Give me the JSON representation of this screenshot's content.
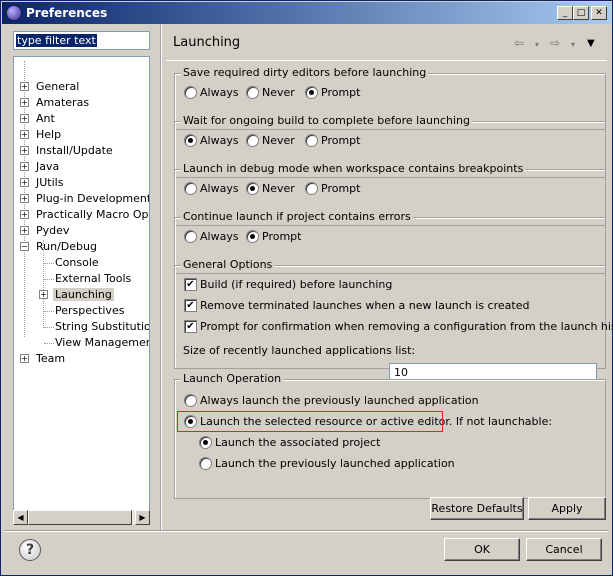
{
  "window": {
    "title": "Preferences"
  },
  "filter": {
    "text": "type filter text"
  },
  "tree": {
    "items": [
      {
        "label": "General"
      },
      {
        "label": "Amateras"
      },
      {
        "label": "Ant"
      },
      {
        "label": "Help"
      },
      {
        "label": "Install/Update"
      },
      {
        "label": "Java"
      },
      {
        "label": "JUtils"
      },
      {
        "label": "Plug-in Development"
      },
      {
        "label": "Practically Macro Option"
      },
      {
        "label": "Pydev"
      },
      {
        "label": "Run/Debug"
      },
      {
        "label": "Console"
      },
      {
        "label": "External Tools"
      },
      {
        "label": "Launching"
      },
      {
        "label": "Perspectives"
      },
      {
        "label": "String Substitution"
      },
      {
        "label": "View Management"
      },
      {
        "label": "Team"
      }
    ]
  },
  "page": {
    "title": "Launching",
    "groups": {
      "save": {
        "title": "Save required dirty editors before launching",
        "options": [
          "Always",
          "Never",
          "Prompt"
        ],
        "selected": "Prompt"
      },
      "wait": {
        "title": "Wait for ongoing build to complete before launching",
        "options": [
          "Always",
          "Never",
          "Prompt"
        ],
        "selected": "Always"
      },
      "debug": {
        "title": "Launch in debug mode when workspace contains breakpoints",
        "options": [
          "Always",
          "Never",
          "Prompt"
        ],
        "selected": "Never"
      },
      "errors": {
        "title": "Continue launch if project contains errors",
        "options": [
          "Always",
          "Prompt"
        ],
        "selected": "Prompt"
      },
      "general": {
        "title": "General Options",
        "build_label": "Build (if required) before launching",
        "remove_label": "Remove terminated launches when a new launch is created",
        "prompt_label": "Prompt for confirmation when removing a configuration from the launch history",
        "size_label": "Size of recently launched applications list:",
        "size_value": "10"
      },
      "launch_op": {
        "title": "Launch Operation",
        "always_previous": "Always launch the previously launched application",
        "launch_selected": "Launch the selected resource or active editor. If not launchable:",
        "associated_project": "Launch the associated project",
        "previous_app": "Launch the previously launched application"
      }
    }
  },
  "buttons": {
    "restore": "Restore Defaults",
    "apply": "Apply",
    "ok": "OK",
    "cancel": "Cancel"
  },
  "icons": {
    "window": "eclipse-icon",
    "help": "help-icon",
    "back": "back-arrow-icon",
    "forward": "forward-arrow-icon",
    "menu": "view-menu-icon"
  }
}
